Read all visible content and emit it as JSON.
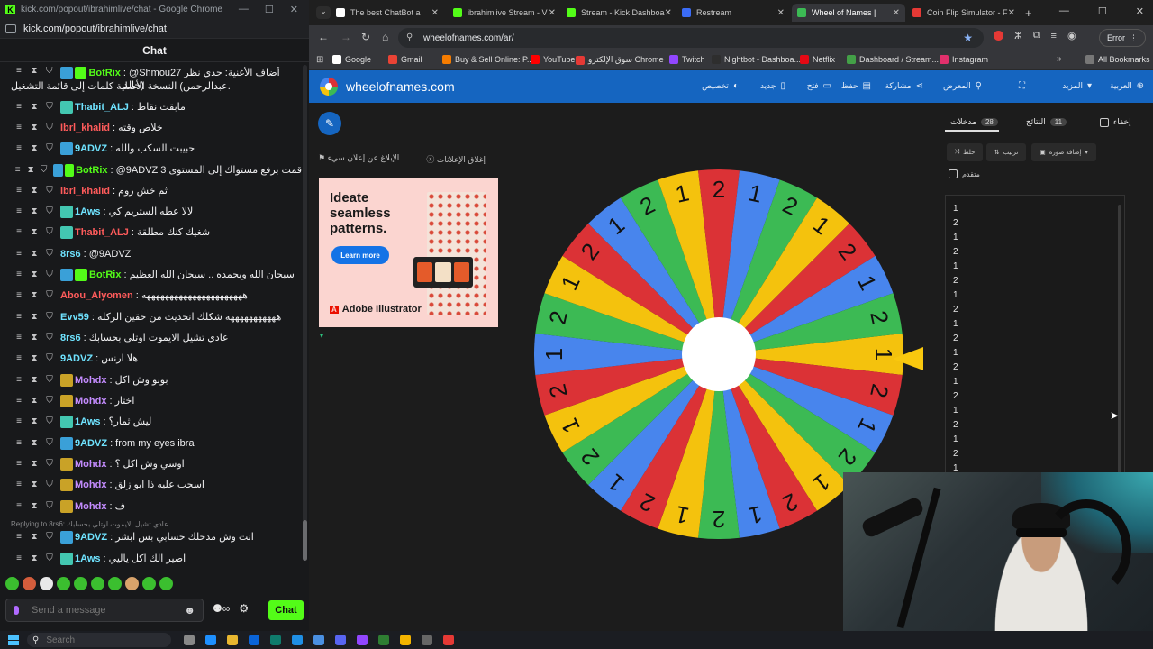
{
  "chat_window": {
    "title": "kick.com/popout/ibrahimlive/chat - Google Chrome",
    "url": "kick.com/popout/ibrahimlive/chat",
    "header": "Chat",
    "messages": [
      {
        "user": "BotRix",
        "color": "#53fc18",
        "text": ": @Shmou27 أضاف الأغنية: حدي نظر (خالد",
        "line2": "عبدالرحمن) النسخة الأصلية كلمات إلى قائمة التشغيل.",
        "badges": [
          "#3aa0d8",
          "#53fc18"
        ]
      },
      {
        "user": "Thabit_ALJ",
        "color": "#6fe3ff",
        "text": ": مابقت نقاط",
        "badges": [
          "#43c7b1"
        ]
      },
      {
        "user": "Ibrl_khalid",
        "color": "#ff5b5b",
        "text": ": خلاص وقته",
        "badges": []
      },
      {
        "user": "9ADVZ",
        "color": "#6fe3ff",
        "text": ": حبيبت السكب والله",
        "badges": [
          "#3aa0d8"
        ]
      },
      {
        "user": "BotRix",
        "color": "#53fc18",
        "text": ": @9ADVZ 3 قمت برفع مستواك إلى المستوى",
        "badges": [
          "#3aa0d8",
          "#53fc18"
        ]
      },
      {
        "user": "Ibrl_khalid",
        "color": "#ff5b5b",
        "text": ": ثم خش روم",
        "badges": []
      },
      {
        "user": "1Aws",
        "color": "#6fe3ff",
        "text": ": لالا عطه الستريم كي",
        "badges": [
          "#43c7b1"
        ]
      },
      {
        "user": "Thabit_ALJ",
        "color": "#ff5b5b",
        "text": ": شغيك كنك مطلقة",
        "badges": [
          "#43c7b1"
        ]
      },
      {
        "user": "8rs6",
        "color": "#6fe3ff",
        "text": ": @9ADVZ",
        "badges": []
      },
      {
        "user": "BotRix",
        "color": "#53fc18",
        "text": ": سبحان الله وبحمده .. سبحان الله العظيم",
        "badges": [
          "#3aa0d8",
          "#53fc18"
        ]
      },
      {
        "user": "Abou_Alyomen",
        "color": "#ff5b5b",
        "text": ": ههههههههههههههههههههههه",
        "badges": []
      },
      {
        "user": "Evv59",
        "color": "#6fe3ff",
        "text": ": هههههههههههه شكلك انحديث من حقين الركله",
        "badges": []
      },
      {
        "user": "8rs6",
        "color": "#6fe3ff",
        "text": ": عادي تشيل الايموت اوتلي بحسابك",
        "badges": []
      },
      {
        "user": "9ADVZ",
        "color": "#6fe3ff",
        "text": ": هلا ارنس",
        "badges": []
      },
      {
        "user": "Mohdx",
        "color": "#c48cff",
        "text": ": بوبو وش اكل",
        "badges": [
          "#c9a227"
        ]
      },
      {
        "user": "Mohdx",
        "color": "#c48cff",
        "text": ": اختار",
        "badges": [
          "#c9a227"
        ]
      },
      {
        "user": "1Aws",
        "color": "#6fe3ff",
        "text": ": ليش ثمار؟",
        "badges": [
          "#43c7b1"
        ]
      },
      {
        "user": "9ADVZ",
        "color": "#6fe3ff",
        "text": ": from my eyes ibra",
        "badges": [
          "#3aa0d8"
        ]
      },
      {
        "user": "Mohdx",
        "color": "#c48cff",
        "text": ": اوسي وش اكل ؟",
        "badges": [
          "#c9a227"
        ]
      },
      {
        "user": "Mohdx",
        "color": "#c48cff",
        "text": ": اسحب عليه ذا ابو زلق",
        "badges": [
          "#c9a227"
        ]
      },
      {
        "user": "Mohdx",
        "color": "#c48cff",
        "text": ": ف",
        "badges": [
          "#c9a227"
        ]
      },
      {
        "user": "9ADVZ",
        "color": "#6fe3ff",
        "text": ": انت وش مدخلك حسابي بس ابشر",
        "badges": [
          "#3aa0d8"
        ]
      },
      {
        "user": "1Aws",
        "color": "#6fe3ff",
        "text": ": اصير الك اكل ياليي",
        "badges": [
          "#43c7b1"
        ]
      }
    ],
    "reply_note": "Replying to 8rs6: عادي تشيل الايموت اوتلي بحسابك",
    "input_placeholder": "Send a message",
    "send_label": "Chat"
  },
  "browser": {
    "tabs": [
      {
        "label": "The best ChatBot a",
        "color": "#ffffff",
        "active": false
      },
      {
        "label": "ibrahimlive Stream - V",
        "color": "#53fc18",
        "active": false
      },
      {
        "label": "Stream - Kick Dashboa",
        "color": "#53fc18",
        "active": false
      },
      {
        "label": "Restream",
        "color": "#3b6cf6",
        "active": false
      },
      {
        "label": "Wheel of Names |",
        "color": "#3cba54",
        "active": true
      },
      {
        "label": "Coin Flip Simulator - F",
        "color": "#e53935",
        "active": false
      }
    ],
    "url": "wheelofnames.com/ar/",
    "error_label": "Error",
    "bookmarks": [
      {
        "label": "Google",
        "color": "#ffffff"
      },
      {
        "label": "Gmail",
        "color": "#ea4335"
      },
      {
        "label": "Buy & Sell Online: P...",
        "color": "#f57c00"
      },
      {
        "label": "YouTube",
        "color": "#ff0000"
      },
      {
        "label": "سوق الإلكترو Chrome",
        "color": "#e53935"
      },
      {
        "label": "Twitch",
        "color": "#9146ff"
      },
      {
        "label": "Nightbot - Dashboa...",
        "color": "#2e2e2e"
      },
      {
        "label": "Netflix",
        "color": "#e50914"
      },
      {
        "label": "Dashboard / Stream...",
        "color": "#43a047"
      },
      {
        "label": "Instagram",
        "color": "#e1306c"
      }
    ],
    "all_bookmarks": "All Bookmarks"
  },
  "wheel_page": {
    "site_title": "wheelofnames.com",
    "nav": [
      {
        "label": "العربية",
        "icon": "globe-icon"
      },
      {
        "label": "المزيد",
        "icon": "chevron-down-icon"
      },
      {
        "label": "",
        "icon": "fullscreen-icon"
      },
      {
        "label": "المعرض",
        "icon": "search-icon"
      },
      {
        "label": "مشاركة",
        "icon": "share-icon"
      },
      {
        "label": "حفظ",
        "icon": "save-icon"
      },
      {
        "label": "فتح",
        "icon": "folder-icon"
      },
      {
        "label": "جديد",
        "icon": "new-icon"
      },
      {
        "label": "تخصيص",
        "icon": "palette-icon"
      }
    ],
    "ad_close": "إغلاق الإعلانات",
    "ad_report": "الإبلاغ عن إعلان سيء",
    "ad": {
      "headline": "Ideate\nseamless\npatterns.",
      "button": "Learn more",
      "brand": "Adobe Illustrator"
    },
    "wheel_labels": [
      "1",
      "2",
      "1",
      "2",
      "1",
      "2",
      "1",
      "2",
      "1",
      "2",
      "1",
      "2",
      "1",
      "2",
      "1",
      "2",
      "1",
      "2",
      "1",
      "2",
      "1",
      "2",
      "1",
      "2",
      "1",
      "2",
      "1",
      "2"
    ],
    "wheel_colors": [
      "#f4c20d",
      "#db3236",
      "#4885ed",
      "#3cba54"
    ],
    "panel": {
      "entries_tab": "مدخلات",
      "entries_count": "28",
      "results_tab": "النتائج",
      "results_count": "11",
      "hide_label": "إخفاء",
      "shuffle": "خلط",
      "sort": "ترتيب",
      "add_image": "إضافة صورة",
      "advanced": "متقدم",
      "entries": [
        "1",
        "2",
        "1",
        "2",
        "1",
        "2",
        "1",
        "2",
        "1",
        "2",
        "1",
        "2",
        "1",
        "2",
        "1",
        "2",
        "1",
        "2",
        "1"
      ]
    }
  },
  "taskbar": {
    "search_placeholder": "Search"
  }
}
